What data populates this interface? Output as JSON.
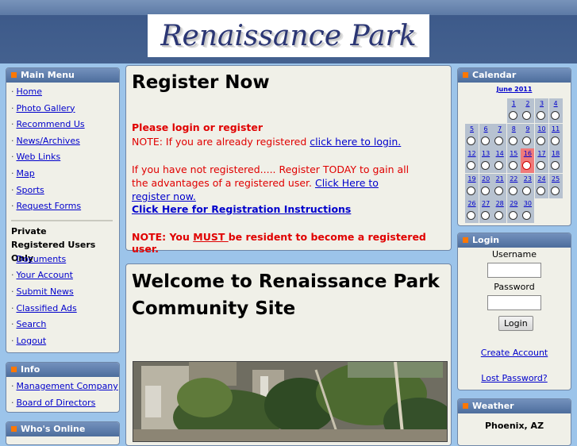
{
  "header": {
    "logo_text": "Renaissance Park"
  },
  "main_menu": {
    "title": "Main Menu",
    "items": [
      "Home",
      "Photo Gallery",
      "Recommend Us",
      "News/Archives",
      "Web Links",
      "Map",
      "Sports",
      "Request Forms"
    ],
    "private_label": "Private",
    "registered_label": "Registered Users Only",
    "private_items": [
      "Documents",
      "Your Account",
      "Submit News",
      "Classified Ads",
      "Search",
      "Logout"
    ]
  },
  "info": {
    "title": "Info",
    "items": [
      "Management Company",
      "Board of Directors"
    ]
  },
  "whos_online": {
    "title": "Who's Online"
  },
  "register": {
    "title": "Register Now",
    "line1": "Please login or register",
    "note_prefix": "NOTE: If you are already registered ",
    "login_link": "click here to login.",
    "not_registered": "If you have not registered..... Register TODAY to gain all the advantages of a registered user. ",
    "register_link": "Click Here to register now.",
    "instructions_link": "Click Here for Registration Instructions",
    "must_prefix": "NOTE: You ",
    "must_word": "MUST ",
    "must_suffix": "be resident to become a registered user."
  },
  "welcome": {
    "title_line1": "Welcome to Renaissance Park",
    "title_line2": "Community Site"
  },
  "calendar": {
    "title": "Calendar",
    "month": "June 2011",
    "today": 16,
    "weeks": [
      [
        null,
        null,
        null,
        1,
        2,
        3,
        4
      ],
      [
        5,
        6,
        7,
        8,
        9,
        10,
        11
      ],
      [
        12,
        13,
        14,
        15,
        16,
        17,
        18
      ],
      [
        19,
        20,
        21,
        22,
        23,
        24,
        25
      ],
      [
        26,
        27,
        28,
        29,
        30,
        null,
        null
      ]
    ]
  },
  "login": {
    "title": "Login",
    "username_label": "Username",
    "password_label": "Password",
    "button": "Login",
    "create_account": "Create Account",
    "lost_password": "Lost Password?"
  },
  "weather": {
    "title": "Weather",
    "location": "Phoenix, AZ"
  },
  "colors": {
    "accent": "#ff7700",
    "header_blue": "#4d6d9c",
    "link": "#0000cc",
    "alert_red": "#e00000"
  }
}
